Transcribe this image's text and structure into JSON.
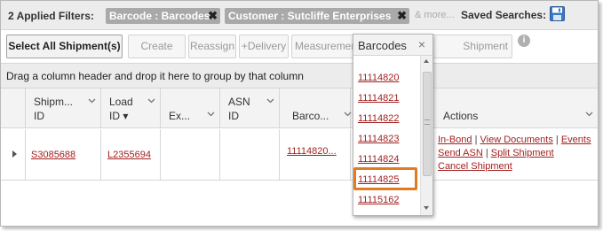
{
  "filter_bar": {
    "count_label": "2 Applied Filters:",
    "chips": [
      {
        "label": "Barcode : Barcodes",
        "close": "✖"
      },
      {
        "label": "Customer : Sutcliffe Enterprises",
        "close": "✖"
      }
    ],
    "more_label": "& more...",
    "saved_searches_label": "Saved Searches:",
    "save_icon": "floppy-disk-icon"
  },
  "toolbar": {
    "select_all": "Select All Shipment(s)",
    "create_bol": "Create BOL",
    "reassign": "Reassign",
    "delivery": "+Delivery",
    "measurement": "Measurement",
    "location": "Shipment Location",
    "info_icon": "i"
  },
  "group_bar": {
    "hint": "Drag a column header and drop it here to group by that column"
  },
  "columns": {
    "shipment": {
      "line1": "Shipm...",
      "line2": "ID"
    },
    "load": {
      "line1": "Load",
      "line2": "ID ▾"
    },
    "ex": {
      "line1": "Ex..."
    },
    "asn": {
      "line1": "ASN",
      "line2": "ID"
    },
    "barcode": {
      "line1": "Barco..."
    },
    "actions": {
      "line1": "Actions"
    }
  },
  "row": {
    "shipment_id": "S3085688",
    "load_id": "L2355694",
    "barcode": "11114820...",
    "actions": {
      "in_bond": "In-Bond",
      "view_documents": "View Documents",
      "events": "Events",
      "send_asn": "Send ASN",
      "split_shipment": "Split Shipment",
      "cancel_shipment": "Cancel Shipment",
      "separator": "|"
    }
  },
  "barcode_dropdown": {
    "title": "Barcodes",
    "close": "×",
    "items": [
      "11114820",
      "11114821",
      "11114822",
      "11114823",
      "11114824",
      "11114825",
      "11115162"
    ],
    "highlighted": "11114825"
  },
  "colors": {
    "link": "#a32020",
    "highlight": "#e07b22",
    "chip_bg": "#a9a9a9",
    "save_icon": "#3a78c2"
  }
}
